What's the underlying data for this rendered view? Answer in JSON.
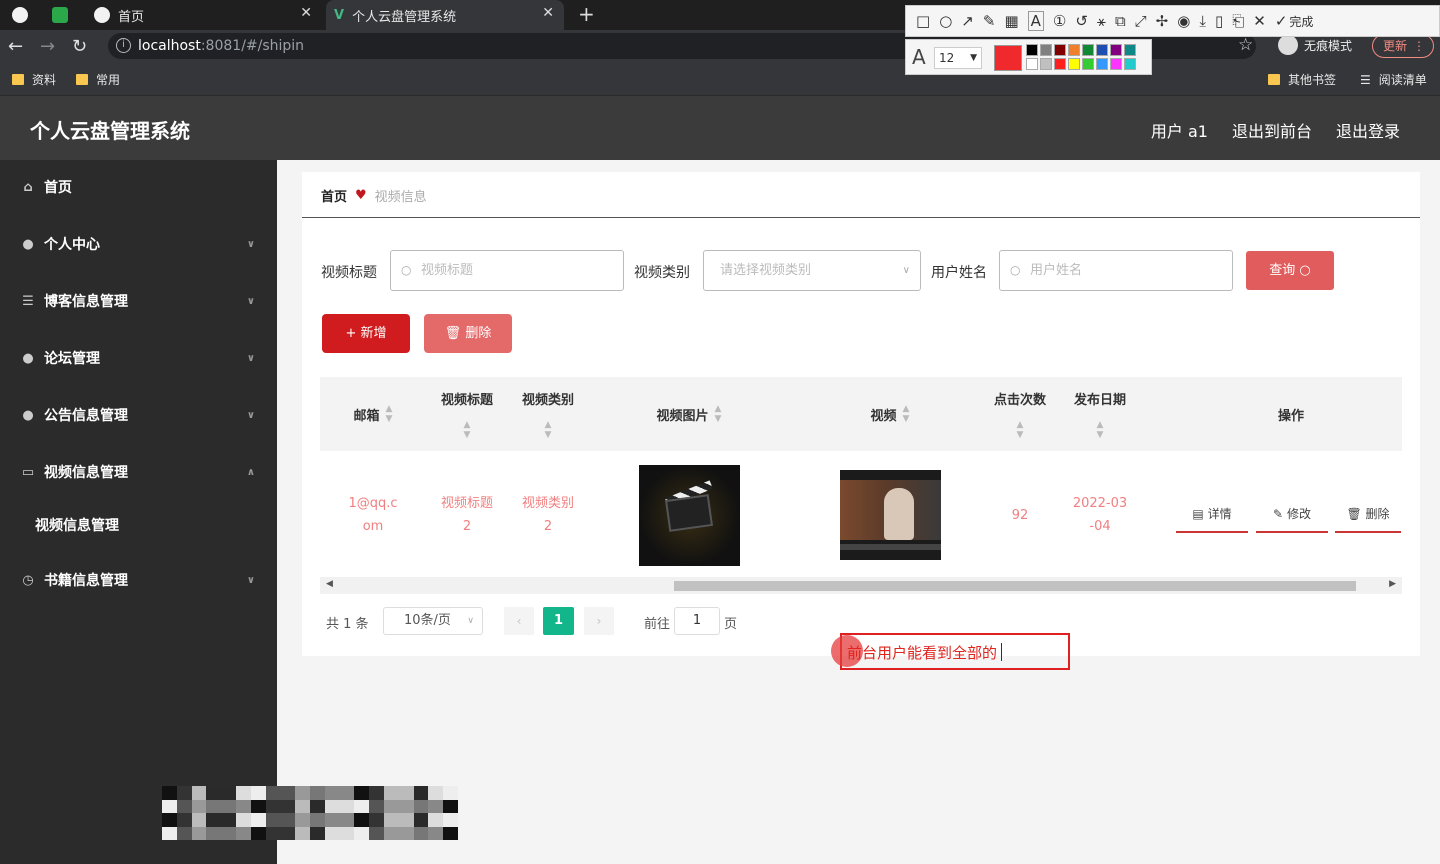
{
  "browser": {
    "tabs": [
      {
        "label": "首页"
      },
      {
        "label": "个人云盘管理系统"
      }
    ],
    "url_host": "localhost",
    "url_port_path": ":8081/#/shipin",
    "profile_label": "无痕模式",
    "update_label": "更新",
    "bookmarks": [
      "资料",
      "常用"
    ],
    "other_bookmarks": "其他书签",
    "reading_list": "阅读清单"
  },
  "annotation_toolbar": {
    "done_label": "完成",
    "font_size": "12",
    "current_color": "#f0292d",
    "palette": [
      "#000000",
      "#808080",
      "#800000",
      "#f07f2c",
      "#118833",
      "#1f4fb0",
      "#800080",
      "#118888",
      "#ffffff",
      "#c0c0c0",
      "#ff2020",
      "#ffff00",
      "#33cc33",
      "#3399ff",
      "#ff33ff",
      "#22cccc"
    ]
  },
  "app": {
    "title": "个人云盘管理系统",
    "header_links": [
      "用户 a1",
      "退出到前台",
      "退出登录"
    ]
  },
  "sidebar": {
    "items": [
      {
        "label": "首页",
        "icon": "home-icon"
      },
      {
        "label": "个人中心",
        "icon": "user-icon"
      },
      {
        "label": "博客信息管理",
        "icon": "list-icon"
      },
      {
        "label": "论坛管理",
        "icon": "user-icon"
      },
      {
        "label": "公告信息管理",
        "icon": "user-icon"
      },
      {
        "label": "视频信息管理",
        "icon": "monitor-icon"
      },
      {
        "label": "书籍信息管理",
        "icon": "clock-icon"
      }
    ],
    "submenu_label": "视频信息管理"
  },
  "breadcrumb": {
    "home": "首页",
    "current": "视频信息"
  },
  "search": {
    "title_label": "视频标题",
    "title_placeholder": "视频标题",
    "category_label": "视频类别",
    "category_placeholder": "请选择视频类别",
    "user_label": "用户姓名",
    "user_placeholder": "用户姓名",
    "query_button": "查询"
  },
  "actions": {
    "add": "新增",
    "delete": "删除"
  },
  "table": {
    "headers": [
      "邮箱",
      "视频标题",
      "视频类别",
      "视频图片",
      "视频",
      "点击次数",
      "发布日期",
      "操作"
    ],
    "rows": [
      {
        "email_line1": "1@qq.c",
        "email_line2": "om",
        "title_line1": "视频标题",
        "title_line2": "2",
        "category_line1": "视频类别",
        "category_line2": "2",
        "clicks": "92",
        "date_line1": "2022-03",
        "date_line2": "-04",
        "ops": [
          "详情",
          "修改",
          "删除"
        ]
      }
    ]
  },
  "pagination": {
    "total": "共 1 条",
    "page_size": "10条/页",
    "current_page": "1",
    "goto_label": "前往",
    "goto_value": "1",
    "page_suffix": "页"
  },
  "note": {
    "text": "前台用户能看到全部的"
  }
}
